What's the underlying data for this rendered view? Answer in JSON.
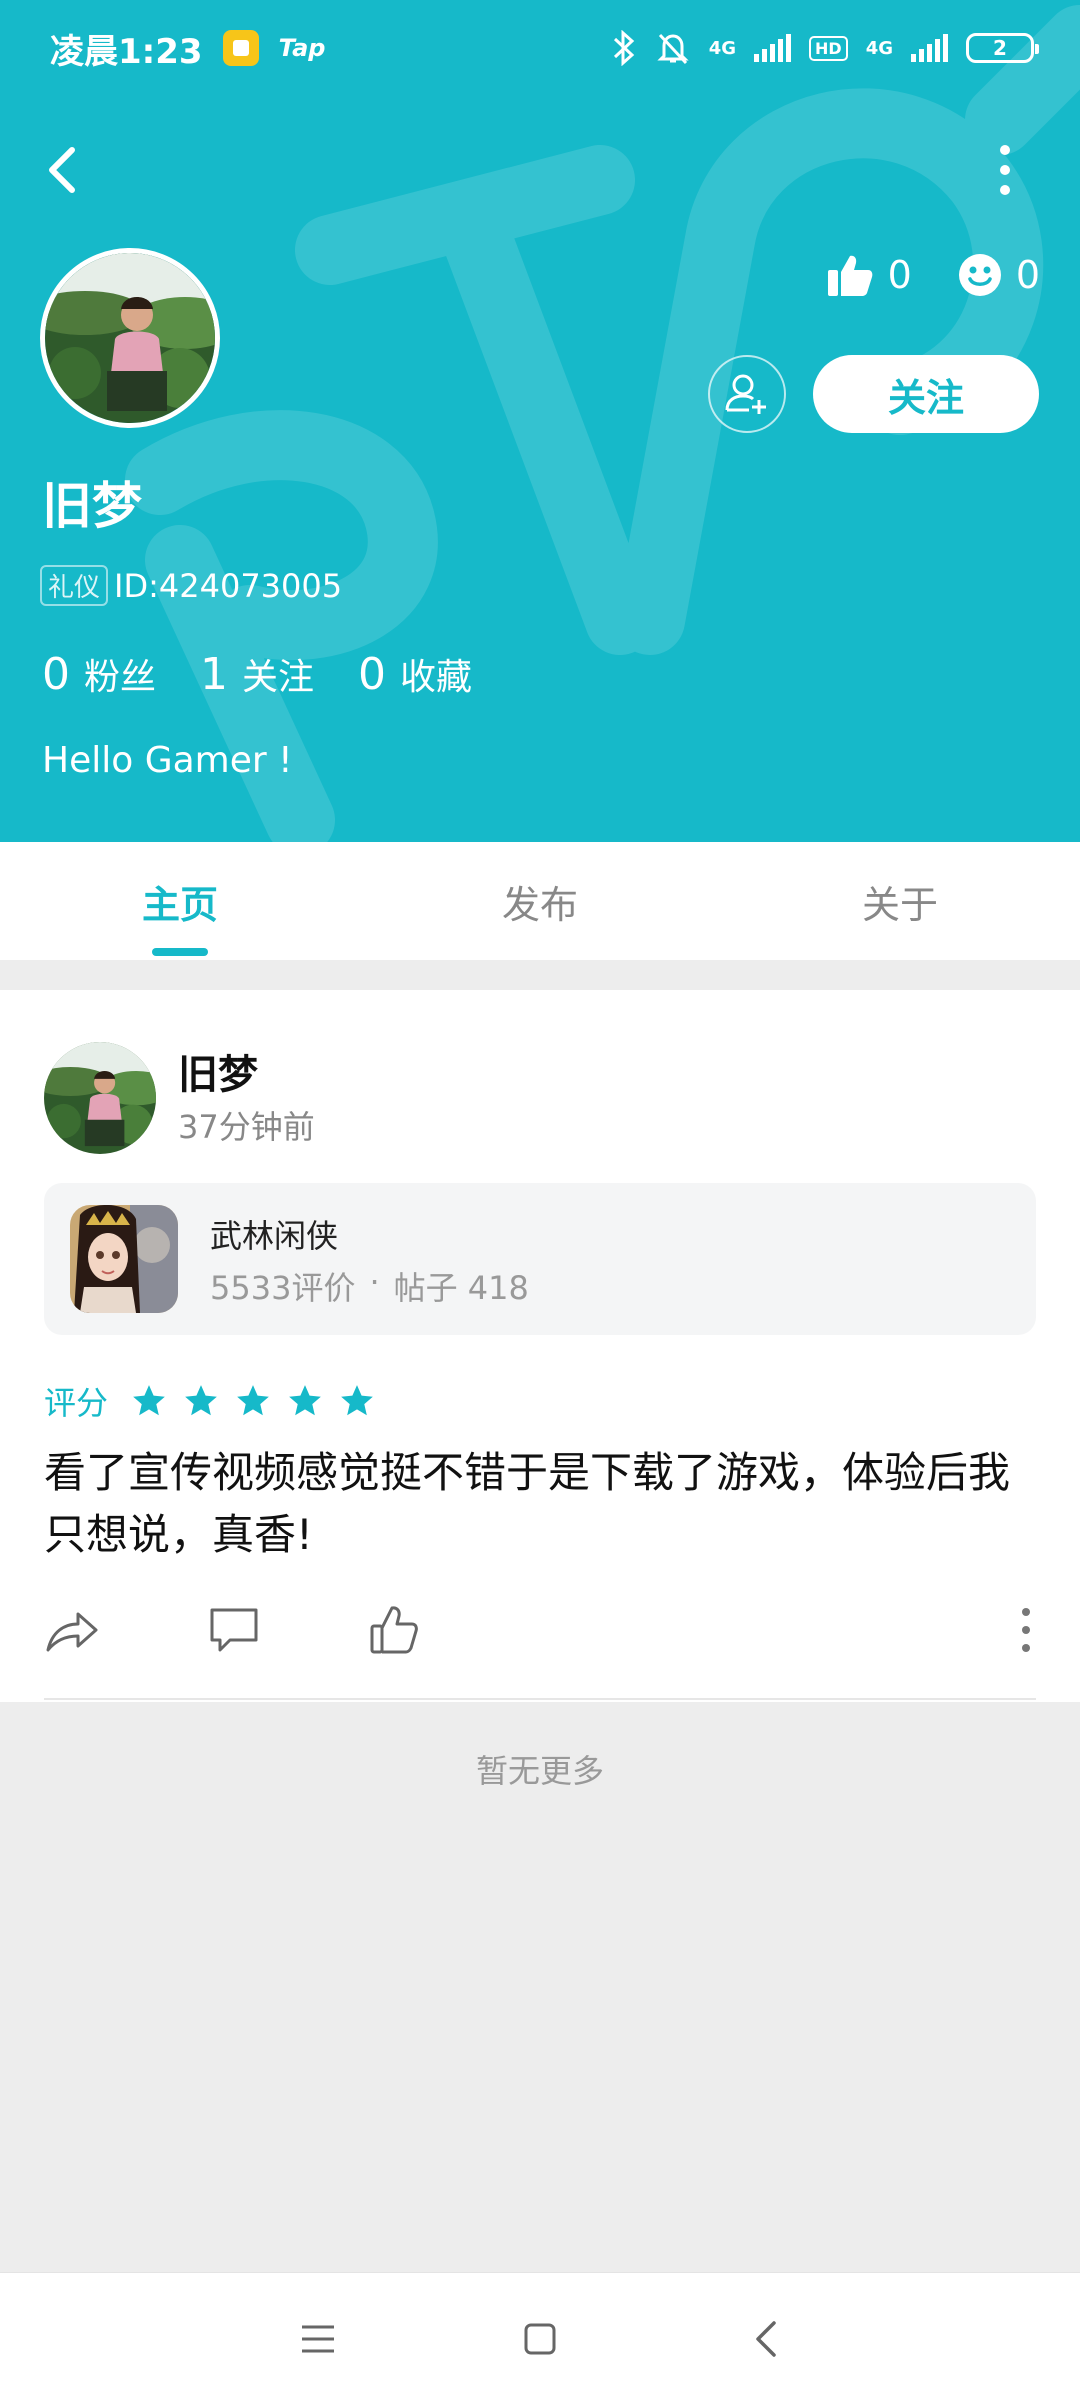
{
  "status_bar": {
    "time": "凌晨1:23",
    "app_label": "Tap",
    "network_1": "4G",
    "hd": "HD",
    "network_2": "4G",
    "battery": "2"
  },
  "profile": {
    "name": "旧梦",
    "tag": "礼仪",
    "id_text": "ID:424073005",
    "fans_count": "0",
    "fans_label": "粉丝",
    "following_count": "1",
    "following_label": "关注",
    "favorites_count": "0",
    "favorites_label": "收藏",
    "bio": "Hello Gamer !",
    "likes_count": "0",
    "smiles_count": "0",
    "follow_button": "关注"
  },
  "tabs": [
    {
      "label": "主页",
      "active": true
    },
    {
      "label": "发布",
      "active": false
    },
    {
      "label": "关于",
      "active": false
    }
  ],
  "post": {
    "author": "旧梦",
    "time": "37分钟前",
    "game": {
      "name": "武林闲侠",
      "reviews": "5533评价",
      "separator": "·",
      "posts": "帖子 418"
    },
    "rating_label": "评分",
    "rating_stars": 5,
    "text": "看了宣传视频感觉挺不错于是下载了游戏，体验后我只想说，真香!"
  },
  "footer": {
    "no_more": "暂无更多"
  },
  "colors": {
    "accent": "#16b9c9"
  }
}
